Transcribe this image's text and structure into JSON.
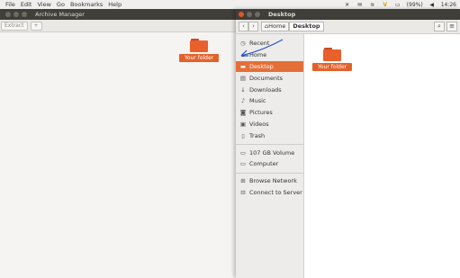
{
  "panel": {
    "menus": [
      "File",
      "Edit",
      "View",
      "Go",
      "Bookmarks",
      "Help"
    ],
    "battery": "(99%)",
    "clock": "14:26"
  },
  "archive": {
    "title": "Archive Manager",
    "extract_label": "Extract",
    "add_label": "+",
    "folder_label": "Your folder"
  },
  "files": {
    "title": "Desktop",
    "breadcrumb": [
      "Home",
      "Desktop"
    ],
    "sidebar": {
      "places": [
        {
          "label": "Recent",
          "icon": "clock-icon"
        },
        {
          "label": "Home",
          "icon": "home-icon"
        },
        {
          "label": "Desktop",
          "icon": "desktop-folder-icon",
          "active": true
        },
        {
          "label": "Documents",
          "icon": "documents-icon"
        },
        {
          "label": "Downloads",
          "icon": "downloads-icon"
        },
        {
          "label": "Music",
          "icon": "music-icon"
        },
        {
          "label": "Pictures",
          "icon": "pictures-icon"
        },
        {
          "label": "Videos",
          "icon": "videos-icon"
        },
        {
          "label": "Trash",
          "icon": "trash-icon"
        }
      ],
      "devices": [
        {
          "label": "107 GB Volume",
          "icon": "drive-icon"
        },
        {
          "label": "Computer",
          "icon": "computer-icon"
        }
      ],
      "network": [
        {
          "label": "Browse Network",
          "icon": "network-icon"
        },
        {
          "label": "Connect to Server",
          "icon": "server-icon"
        }
      ]
    },
    "folder_label": "Your folder"
  },
  "colors": {
    "accent": "#e46f38",
    "folder": "#e8602c",
    "titlebar": "#3f3e39"
  }
}
